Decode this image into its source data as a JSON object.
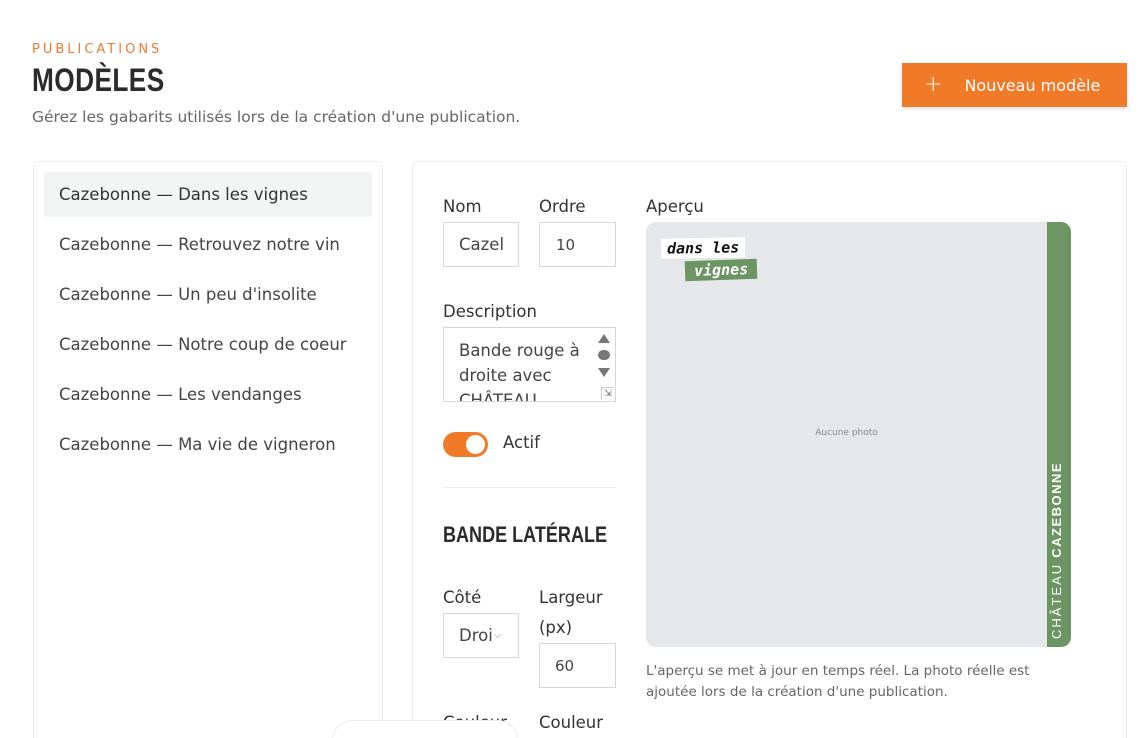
{
  "header": {
    "eyebrow": "PUBLICATIONS",
    "title": "MODÈLES",
    "subtitle": "Gérez les gabarits utilisés lors de la création d'une publication.",
    "new_button_label": "Nouveau modèle",
    "new_button_icon": "plus-icon"
  },
  "templates": {
    "active_index": 0,
    "items": [
      {
        "label": "Cazebonne — Dans les vignes"
      },
      {
        "label": "Cazebonne — Retrouvez notre vin"
      },
      {
        "label": "Cazebonne — Un peu d'insolite"
      },
      {
        "label": "Cazebonne — Notre coup de coeur"
      },
      {
        "label": "Cazebonne — Les vendanges"
      },
      {
        "label": "Cazebonne — Ma vie de vigneron"
      }
    ]
  },
  "form": {
    "name_label": "Nom",
    "name_value": "Cazel",
    "order_label": "Ordre",
    "order_value": "10",
    "description_label": "Description",
    "description_value": "Bande rouge à droite avec CHÂTEAU",
    "active_label": "Actif",
    "active_on": true,
    "section_title": "BANDE LATÉRALE",
    "side_label": "Côté",
    "side_value": "Droi",
    "width_label": "Largeur (px)",
    "width_value": "60",
    "color_label_1": "Couleur",
    "color_label_2": "Couleur"
  },
  "preview": {
    "label": "Aperçu",
    "tag_line1": "dans les",
    "tag_line2": "vignes",
    "no_photo": "Aucune photo",
    "band_text_light": "CHÂTEAU",
    "band_text_bold": "CAZEBONNE",
    "note": "L'aperçu se met à jour en temps réel. La photo réelle est ajoutée lors de la création d'une publication.",
    "colors": {
      "background": "#e6e7ea",
      "band": "#6c9563",
      "accent": "#f07a28"
    }
  }
}
